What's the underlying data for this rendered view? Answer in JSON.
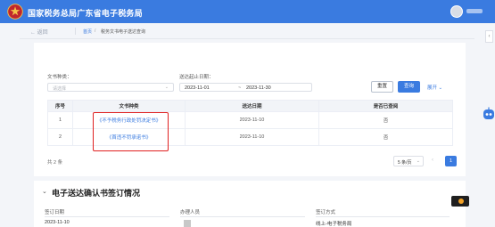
{
  "header": {
    "site_title": "国家税务总局广东省电子税务局"
  },
  "breadcrumb": {
    "back_label": "← 返回",
    "home": "首页",
    "divider": "/",
    "current": "税务文书电子送达查询"
  },
  "filters": {
    "doc_type_label": "文书种类：",
    "doc_type_placeholder": "请选择",
    "date_label": "送达起止日期：",
    "date_start": "2023-11-01",
    "date_separator": "~",
    "date_end": "2023-11-30",
    "reset_label": "重置",
    "query_label": "查询",
    "expand_label": "展开 ⌄"
  },
  "table": {
    "headers": [
      "序号",
      "文书种类",
      "送达日期",
      "是否已查阅"
    ],
    "rows": [
      {
        "index": "1",
        "doc_type": "《不予税务行政处罚决定书》",
        "date": "2023-11-10",
        "viewed": "否"
      },
      {
        "index": "2",
        "doc_type": "《首违不罚承诺书》",
        "date": "2023-11-10",
        "viewed": "否"
      }
    ]
  },
  "pagination": {
    "total_text": "共 2 条",
    "page_size": "5 条/页",
    "current_page": "1",
    "prev": "‹"
  },
  "confirm_section": {
    "title": "电子送达确认书签订情况",
    "fields": {
      "sign_date_label": "签订日期",
      "sign_date_value": "2023-11-10",
      "operator_label": "办理人员",
      "method_label": "签订方式",
      "method_value": "线上-电子税务局"
    }
  },
  "colors": {
    "primary": "#3a7be0",
    "highlight": "#e02020"
  }
}
